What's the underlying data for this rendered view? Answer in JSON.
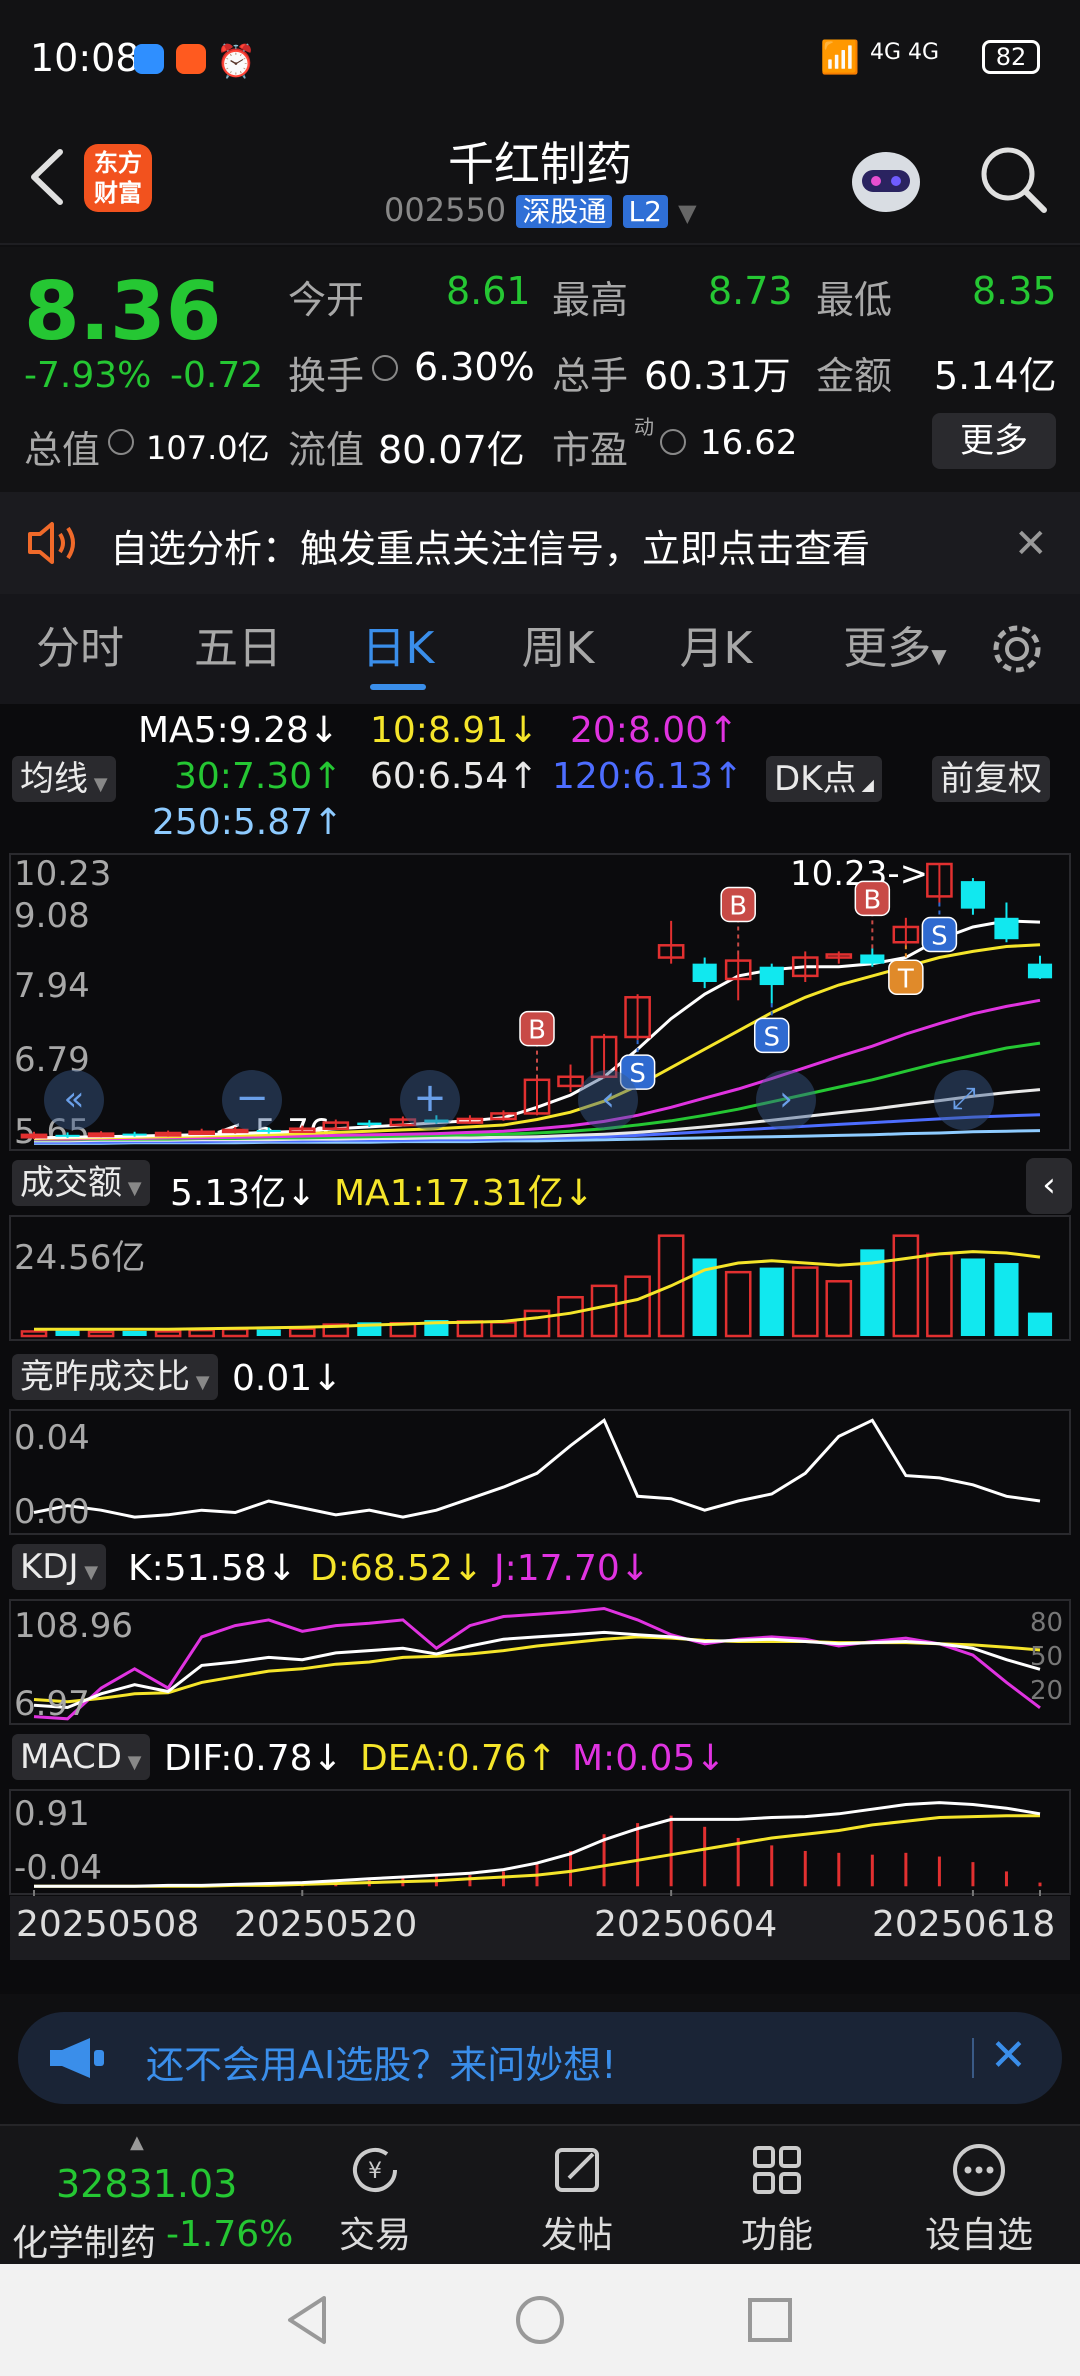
{
  "status": {
    "time": "10:08",
    "network": "4G 4G",
    "battery": "82"
  },
  "header": {
    "logo": "东方\n财富",
    "logo_line1": "东方",
    "logo_line2": "财富",
    "title": "千红制药",
    "code": "002550",
    "badge_sgt": "深股通",
    "badge_l2": "L2"
  },
  "quote": {
    "price": "8.36",
    "change_pct": "-7.93%",
    "change": "-0.72",
    "open_label": "今开",
    "open": "8.61",
    "high_label": "最高",
    "high": "8.73",
    "low_label": "最低",
    "low": "8.35",
    "turnover_label": "换手",
    "turnover": "6.30%",
    "volume_label": "总手",
    "volume": "60.31万",
    "amount_label": "金额",
    "amount": "5.14亿",
    "mktcap_label": "总值",
    "mktcap": "107.0亿",
    "float_label": "流值",
    "float": "80.07亿",
    "pe_label": "市盈",
    "pe_sup": "动",
    "pe": "16.62",
    "more": "更多"
  },
  "alert": {
    "text": "自选分析：触发重点关注信号，立即点击查看"
  },
  "tabs": [
    {
      "label": "分时"
    },
    {
      "label": "五日"
    },
    {
      "label": "日K"
    },
    {
      "label": "周K"
    },
    {
      "label": "月K"
    },
    {
      "label": "更多"
    }
  ],
  "ma": {
    "chip": "均线",
    "ma5": "MA5:9.28",
    "ma10": "10:8.91",
    "ma20": "20:8.00",
    "ma30": "30:7.30",
    "ma60": "60:6.54",
    "ma120": "120:6.13",
    "ma250": "250:5.87",
    "dk": "DK点",
    "fq": "前复权"
  },
  "kline": {
    "y1": "10.23",
    "y2": "9.08",
    "y3": "7.94",
    "y4": "6.79",
    "y5": "5.65",
    "max_label": "10.23->",
    "min_label": "<-5.76"
  },
  "volume": {
    "chip": "成交额",
    "value": "5.13亿",
    "ma1": "MA1:17.31亿",
    "ymax": "24.56亿"
  },
  "jzb": {
    "chip": "竞昨成交比",
    "value": "0.01",
    "ymax": "0.04",
    "ymin": "0.00"
  },
  "kdj": {
    "chip": "KDJ",
    "k": "K:51.58",
    "d": "D:68.52",
    "j": "J:17.70",
    "ymax": "108.96",
    "ymin": "6.97",
    "r80": "80",
    "r50": "50",
    "r20": "20"
  },
  "macd": {
    "chip": "MACD",
    "dif": "DIF:0.78",
    "dea": "DEA:0.76",
    "m": "M:0.05",
    "ymax": "0.91",
    "ymin": "-0.04"
  },
  "dates": [
    "20250508",
    "20250520",
    "20250604",
    "20250618"
  ],
  "promo": {
    "text": "还不会用AI选股？来问妙想!"
  },
  "bottom": {
    "index_value": "32831.03",
    "index_name": "化学制药",
    "index_change": "-1.76%",
    "items": [
      {
        "label": "交易"
      },
      {
        "label": "发帖"
      },
      {
        "label": "功能"
      },
      {
        "label": "设自选"
      }
    ]
  },
  "colors": {
    "up": "#e23030",
    "down": "#25c733",
    "cyan": "#11e8ef",
    "yellow": "#f5e52a",
    "magenta": "#e033e0",
    "accent": "#3a8eea"
  },
  "chart_data": {
    "type": "candlestick",
    "candles": [
      {
        "o": 5.76,
        "c": 5.8,
        "h": 5.85,
        "l": 5.73
      },
      {
        "o": 5.8,
        "c": 5.78,
        "h": 5.84,
        "l": 5.75
      },
      {
        "o": 5.78,
        "c": 5.82,
        "h": 5.86,
        "l": 5.76
      },
      {
        "o": 5.82,
        "c": 5.79,
        "h": 5.85,
        "l": 5.77
      },
      {
        "o": 5.79,
        "c": 5.83,
        "h": 5.87,
        "l": 5.77
      },
      {
        "o": 5.83,
        "c": 5.85,
        "h": 5.9,
        "l": 5.8
      },
      {
        "o": 5.85,
        "c": 5.88,
        "h": 5.93,
        "l": 5.82
      },
      {
        "o": 5.88,
        "c": 5.85,
        "h": 5.92,
        "l": 5.82
      },
      {
        "o": 5.85,
        "c": 5.9,
        "h": 5.95,
        "l": 5.83
      },
      {
        "o": 5.9,
        "c": 6.0,
        "h": 6.05,
        "l": 5.88
      },
      {
        "o": 6.0,
        "c": 5.96,
        "h": 6.04,
        "l": 5.93
      },
      {
        "o": 5.96,
        "c": 6.05,
        "h": 6.1,
        "l": 5.94
      },
      {
        "o": 6.05,
        "c": 6.0,
        "h": 6.12,
        "l": 5.98
      },
      {
        "o": 6.0,
        "c": 6.06,
        "h": 6.12,
        "l": 5.98
      },
      {
        "o": 6.06,
        "c": 6.15,
        "h": 6.2,
        "l": 6.03
      },
      {
        "o": 6.15,
        "c": 6.7,
        "h": 6.72,
        "l": 6.12
      },
      {
        "o": 6.6,
        "c": 6.75,
        "h": 6.95,
        "l": 6.5
      },
      {
        "o": 6.75,
        "c": 7.4,
        "h": 7.45,
        "l": 6.72
      },
      {
        "o": 7.4,
        "c": 8.05,
        "h": 8.1,
        "l": 7.35
      },
      {
        "o": 8.7,
        "c": 8.9,
        "h": 9.3,
        "l": 8.6
      },
      {
        "o": 8.6,
        "c": 8.3,
        "h": 8.7,
        "l": 8.2
      },
      {
        "o": 8.35,
        "c": 8.65,
        "h": 8.75,
        "l": 8.0
      },
      {
        "o": 8.55,
        "c": 8.25,
        "h": 8.6,
        "l": 7.95
      },
      {
        "o": 8.4,
        "c": 8.7,
        "h": 8.8,
        "l": 8.3
      },
      {
        "o": 8.7,
        "c": 8.75,
        "h": 8.8,
        "l": 8.6
      },
      {
        "o": 8.75,
        "c": 8.6,
        "h": 8.85,
        "l": 8.55
      },
      {
        "o": 8.95,
        "c": 9.2,
        "h": 9.35,
        "l": 8.9
      },
      {
        "o": 9.7,
        "c": 10.23,
        "h": 10.23,
        "l": 9.6
      },
      {
        "o": 9.95,
        "c": 9.5,
        "h": 10.0,
        "l": 9.4
      },
      {
        "o": 9.35,
        "c": 9.0,
        "h": 9.6,
        "l": 8.95
      },
      {
        "o": 8.6,
        "c": 8.36,
        "h": 8.73,
        "l": 8.35
      }
    ],
    "volume": [
      1.0,
      1.2,
      0.9,
      1.1,
      1.0,
      1.3,
      1.5,
      1.4,
      1.6,
      2.5,
      3.0,
      2.8,
      3.5,
      3.2,
      3.0,
      5.5,
      8.5,
      11.0,
      13.0,
      22.0,
      17.0,
      14.0,
      15.0,
      15.0,
      12.0,
      19.0,
      22.0,
      18.0,
      17.0,
      16.0,
      5.13
    ],
    "ma1": [
      1.5,
      1.5,
      1.5,
      1.5,
      1.5,
      1.6,
      1.7,
      1.8,
      1.9,
      2.1,
      2.4,
      2.6,
      2.9,
      3.0,
      3.2,
      4.0,
      5.0,
      6.5,
      8.0,
      11.0,
      14.5,
      16.0,
      16.5,
      16.0,
      15.5,
      16.0,
      17.0,
      18.0,
      18.5,
      18.2,
      17.31
    ],
    "jzb": [
      0.005,
      0.008,
      0.006,
      0.003,
      0.004,
      0.006,
      0.005,
      0.01,
      0.007,
      0.004,
      0.006,
      0.003,
      0.006,
      0.011,
      0.016,
      0.022,
      0.034,
      0.045,
      0.012,
      0.011,
      0.006,
      0.01,
      0.013,
      0.022,
      0.038,
      0.045,
      0.021,
      0.02,
      0.017,
      0.012,
      0.01
    ],
    "kdj_k": [
      20,
      18,
      30,
      38,
      32,
      55,
      58,
      62,
      60,
      66,
      68,
      70,
      65,
      72,
      78,
      80,
      82,
      84,
      82,
      80,
      76,
      77,
      78,
      76,
      74,
      75,
      76,
      74,
      70,
      60,
      51.58
    ],
    "kdj_d": [
      25,
      23,
      26,
      30,
      31,
      40,
      45,
      50,
      52,
      56,
      58,
      62,
      63,
      65,
      68,
      72,
      75,
      78,
      80,
      79,
      77,
      76,
      76,
      76,
      75,
      75,
      75,
      74,
      73,
      71,
      68.52
    ],
    "kdj_j": [
      10,
      8,
      35,
      52,
      35,
      80,
      90,
      95,
      85,
      90,
      92,
      95,
      70,
      90,
      98,
      100,
      102,
      105,
      95,
      82,
      74,
      78,
      80,
      78,
      72,
      76,
      79,
      74,
      64,
      40,
      17.7
    ],
    "dif": [
      0.0,
      0.0,
      0.0,
      0.0,
      0.01,
      0.01,
      0.02,
      0.03,
      0.04,
      0.06,
      0.08,
      0.1,
      0.12,
      0.14,
      0.18,
      0.25,
      0.35,
      0.5,
      0.62,
      0.72,
      0.72,
      0.72,
      0.74,
      0.75,
      0.78,
      0.83,
      0.88,
      0.9,
      0.88,
      0.84,
      0.78
    ],
    "dea": [
      0.0,
      0.0,
      0.0,
      0.0,
      0.0,
      0.0,
      0.01,
      0.01,
      0.02,
      0.03,
      0.04,
      0.05,
      0.06,
      0.08,
      0.1,
      0.12,
      0.16,
      0.22,
      0.28,
      0.34,
      0.4,
      0.46,
      0.52,
      0.56,
      0.6,
      0.66,
      0.7,
      0.74,
      0.75,
      0.76,
      0.76
    ],
    "ma5": [
      5.75,
      5.76,
      5.77,
      5.78,
      5.79,
      5.8,
      5.82,
      5.84,
      5.86,
      5.9,
      5.93,
      5.96,
      6.0,
      6.03,
      6.08,
      6.25,
      6.45,
      6.75,
      7.2,
      7.7,
      8.1,
      8.4,
      8.5,
      8.55,
      8.55,
      8.6,
      8.7,
      9.0,
      9.2,
      9.3,
      9.28
    ],
    "ma10": [
      5.74,
      5.75,
      5.75,
      5.76,
      5.77,
      5.78,
      5.79,
      5.8,
      5.82,
      5.84,
      5.86,
      5.88,
      5.9,
      5.93,
      5.96,
      6.05,
      6.17,
      6.35,
      6.6,
      6.9,
      7.2,
      7.5,
      7.8,
      8.05,
      8.25,
      8.4,
      8.55,
      8.7,
      8.8,
      8.88,
      8.91
    ],
    "ma20": [
      5.73,
      5.73,
      5.74,
      5.74,
      5.75,
      5.75,
      5.76,
      5.77,
      5.78,
      5.79,
      5.8,
      5.81,
      5.82,
      5.84,
      5.86,
      5.9,
      5.95,
      6.02,
      6.12,
      6.25,
      6.4,
      6.55,
      6.72,
      6.9,
      7.08,
      7.25,
      7.45,
      7.62,
      7.78,
      7.9,
      8.0
    ],
    "ma30": [
      5.72,
      5.72,
      5.73,
      5.73,
      5.73,
      5.74,
      5.74,
      5.75,
      5.75,
      5.76,
      5.77,
      5.78,
      5.79,
      5.8,
      5.81,
      5.83,
      5.86,
      5.9,
      5.96,
      6.03,
      6.12,
      6.22,
      6.34,
      6.46,
      6.58,
      6.7,
      6.84,
      6.98,
      7.1,
      7.22,
      7.3
    ],
    "ma60": [
      5.7,
      5.7,
      5.71,
      5.71,
      5.71,
      5.72,
      5.72,
      5.72,
      5.73,
      5.73,
      5.74,
      5.74,
      5.75,
      5.75,
      5.76,
      5.77,
      5.79,
      5.81,
      5.84,
      5.88,
      5.93,
      5.98,
      6.04,
      6.1,
      6.16,
      6.22,
      6.29,
      6.36,
      6.43,
      6.49,
      6.54
    ],
    "ma120": [
      5.68,
      5.68,
      5.68,
      5.69,
      5.69,
      5.69,
      5.7,
      5.7,
      5.7,
      5.71,
      5.71,
      5.71,
      5.72,
      5.72,
      5.73,
      5.74,
      5.75,
      5.77,
      5.79,
      5.82,
      5.85,
      5.88,
      5.91,
      5.94,
      5.97,
      6.0,
      6.03,
      6.06,
      6.09,
      6.11,
      6.13
    ],
    "ma250": [
      5.66,
      5.66,
      5.66,
      5.67,
      5.67,
      5.67,
      5.67,
      5.68,
      5.68,
      5.68,
      5.68,
      5.69,
      5.69,
      5.69,
      5.7,
      5.7,
      5.71,
      5.72,
      5.73,
      5.74,
      5.75,
      5.76,
      5.77,
      5.78,
      5.79,
      5.8,
      5.82,
      5.83,
      5.85,
      5.86,
      5.87
    ],
    "signals": [
      {
        "i": 15,
        "t": "B"
      },
      {
        "i": 18,
        "t": "S"
      },
      {
        "i": 21,
        "t": "B"
      },
      {
        "i": 22,
        "t": "S"
      },
      {
        "i": 25,
        "t": "B"
      },
      {
        "i": 26,
        "t": "T"
      },
      {
        "i": 27,
        "t": "S"
      }
    ]
  }
}
